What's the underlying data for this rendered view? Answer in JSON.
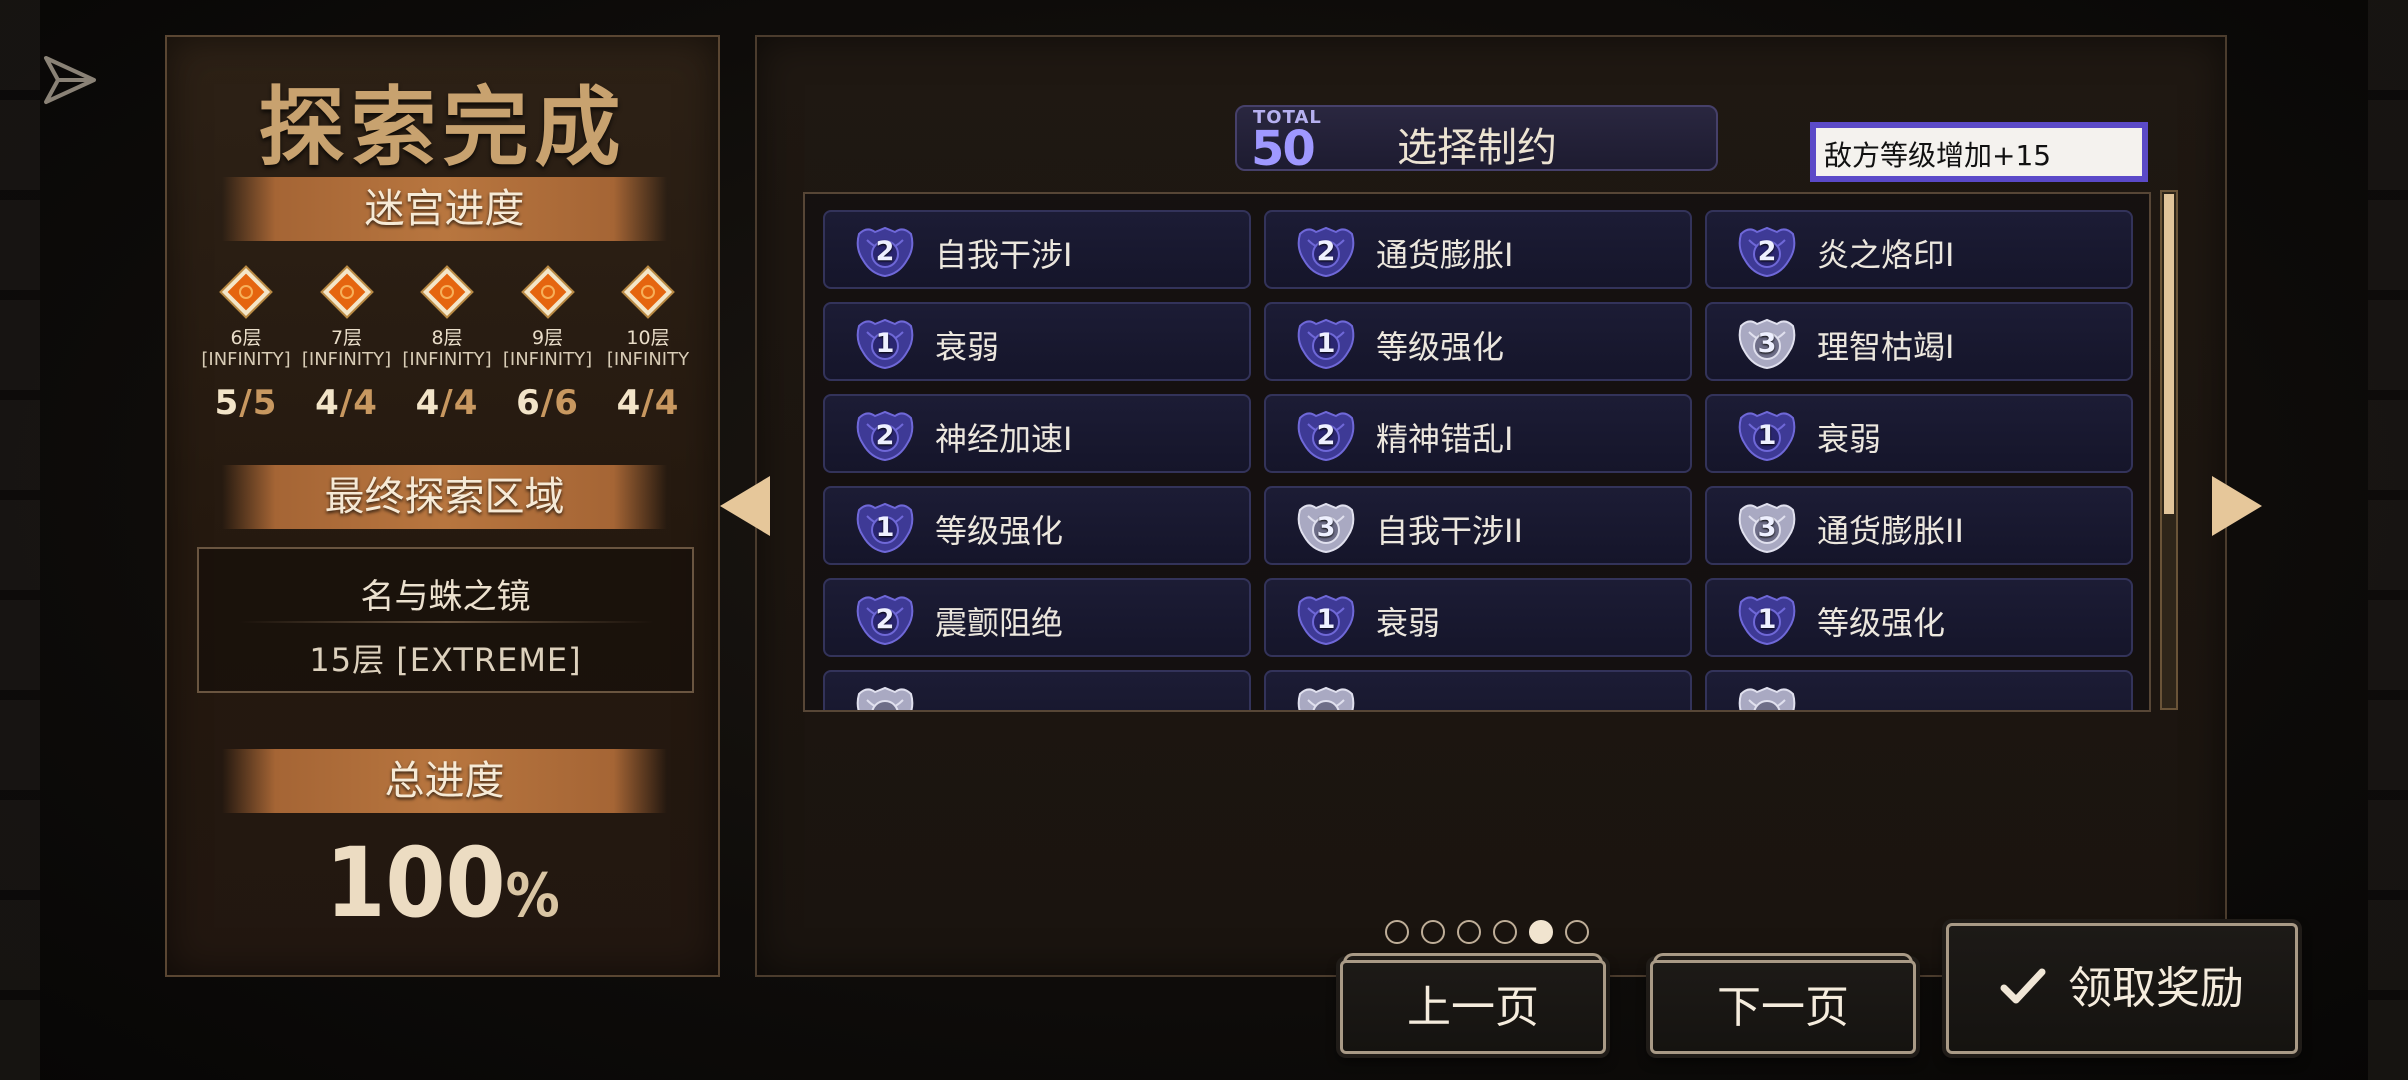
{
  "left_panel": {
    "title": "探索完成",
    "maze_progress_label": "迷宫进度",
    "floors": [
      {
        "name": "6层",
        "mode": "[INFINITY]",
        "current": "5",
        "total": "5"
      },
      {
        "name": "7层",
        "mode": "[INFINITY]",
        "current": "4",
        "total": "4"
      },
      {
        "name": "8层",
        "mode": "[INFINITY]",
        "current": "4",
        "total": "4"
      },
      {
        "name": "9层",
        "mode": "[INFINITY]",
        "current": "6",
        "total": "6"
      },
      {
        "name": "10层",
        "mode": "[INFINITY",
        "current": "4",
        "total": "4"
      }
    ],
    "final_area_label": "最终探索区域",
    "final_area_name": "名与蛛之镜",
    "final_area_level": "15层 [EXTREME]",
    "total_progress_label": "总进度",
    "total_progress_value": "100",
    "total_progress_unit": "%"
  },
  "constraints": {
    "total_label": "TOTAL",
    "total_value": "50",
    "title": "选择制约",
    "selected_effect": "敌方等级增加+15",
    "rows": [
      [
        {
          "level": "2",
          "label": "自我干涉I"
        },
        {
          "level": "2",
          "label": "通货膨胀I"
        },
        {
          "level": "2",
          "label": "炎之烙印I"
        }
      ],
      [
        {
          "level": "1",
          "label": "衰弱"
        },
        {
          "level": "1",
          "label": "等级强化"
        },
        {
          "level": "3",
          "label": "理智枯竭I"
        }
      ],
      [
        {
          "level": "2",
          "label": "神经加速I"
        },
        {
          "level": "2",
          "label": "精神错乱I"
        },
        {
          "level": "1",
          "label": "衰弱"
        }
      ],
      [
        {
          "level": "1",
          "label": "等级强化"
        },
        {
          "level": "3",
          "label": "自我干涉II"
        },
        {
          "level": "3",
          "label": "通货膨胀II"
        }
      ],
      [
        {
          "level": "2",
          "label": "震颤阻绝"
        },
        {
          "level": "1",
          "label": "衰弱"
        },
        {
          "level": "1",
          "label": "等级强化"
        }
      ]
    ],
    "scroll_fraction": 0.62
  },
  "pagination": {
    "pages": 6,
    "active_index": 4
  },
  "buttons": {
    "prev": "上一页",
    "next": "下一页",
    "claim": "领取奖励"
  },
  "colors": {
    "accent_gold": "#c8a26f",
    "badge_blue": "#4a45a8",
    "badge_silver": "#b9b9cc",
    "effect_border": "#5b4ac8"
  }
}
